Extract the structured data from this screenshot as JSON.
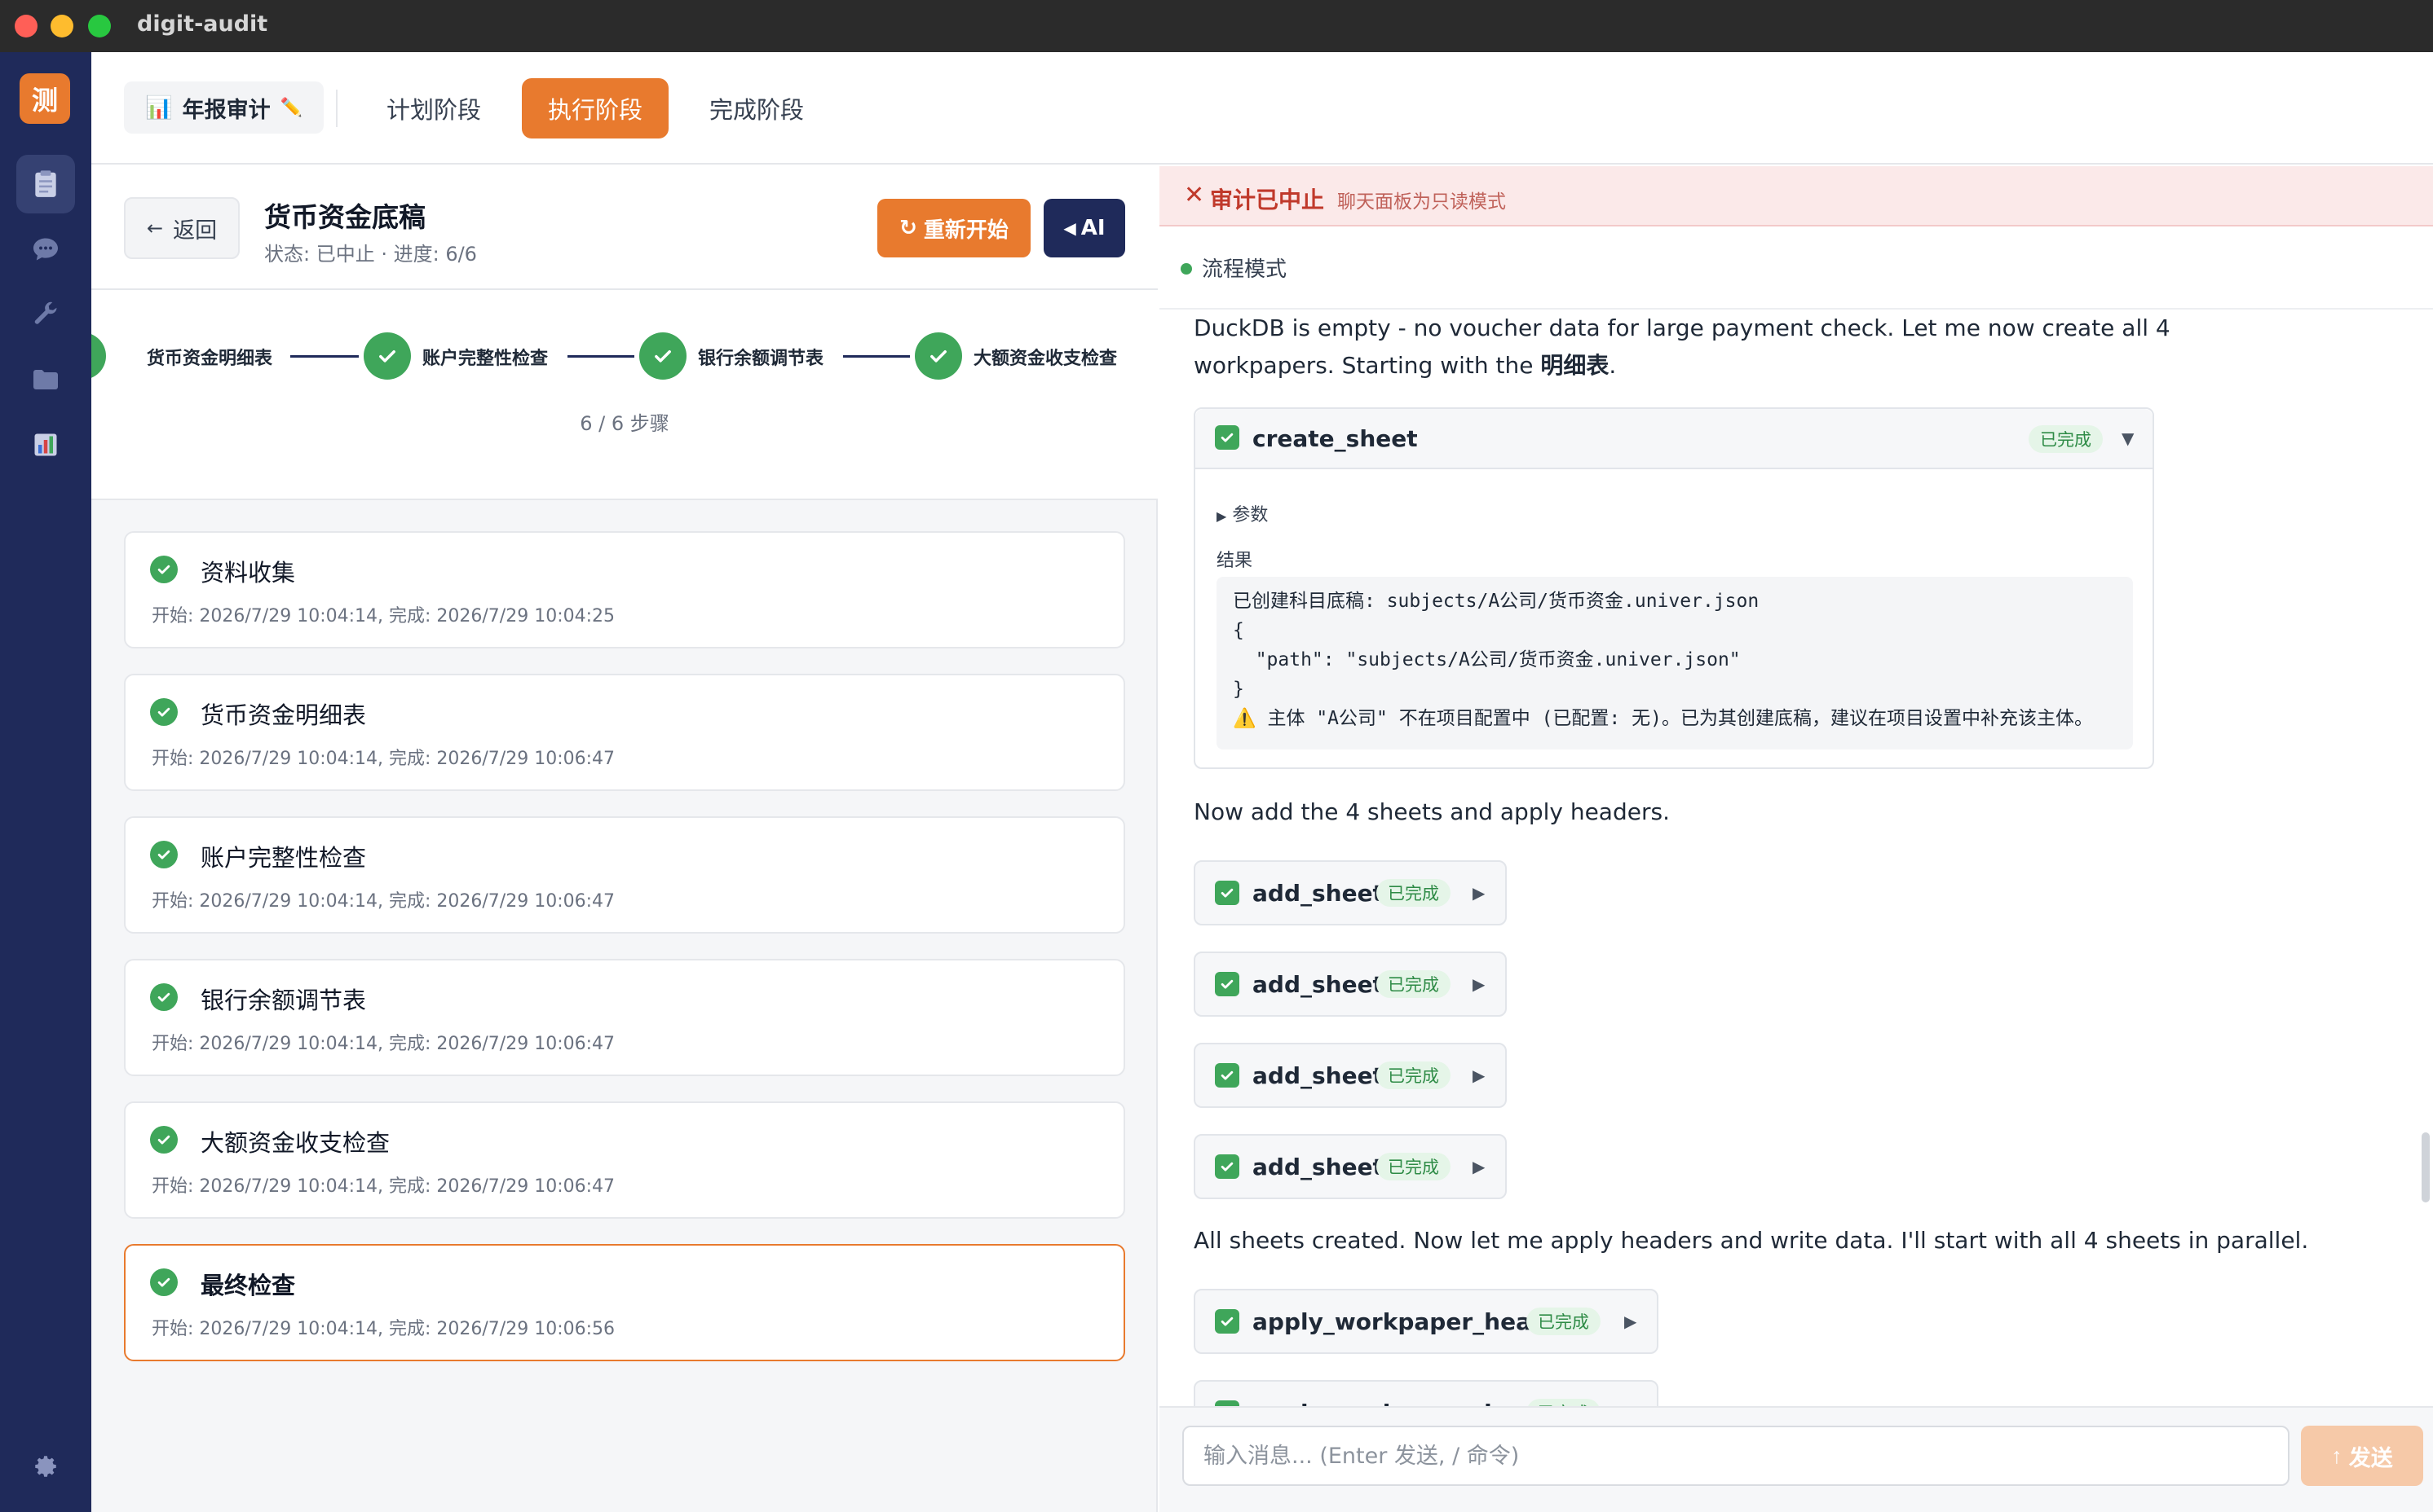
{
  "window": {
    "title": "digit-audit"
  },
  "rail": {
    "logo": "测",
    "items": [
      {
        "icon": "clipboard-icon",
        "active": true
      },
      {
        "icon": "chat-icon",
        "active": false
      },
      {
        "icon": "wrench-icon",
        "active": false
      },
      {
        "icon": "folder-icon",
        "active": false
      },
      {
        "icon": "chart-icon",
        "active": false
      }
    ],
    "settings_icon": "gear-icon"
  },
  "topnav": {
    "project_label": "年报审计",
    "project_emoji": "📊",
    "edit_emoji": "✏️",
    "tabs": [
      {
        "label": "计划阶段",
        "active": false
      },
      {
        "label": "执行阶段",
        "active": true
      },
      {
        "label": "完成阶段",
        "active": false
      }
    ]
  },
  "left": {
    "back_label": "返回",
    "title": "货币资金底稿",
    "status": "状态: 已中止 · 进度: 6/6",
    "restart_label": "重新开始",
    "ai_label": "AI",
    "stepper": {
      "steps": [
        "货币资金明细表",
        "账户完整性检查",
        "银行余额调节表",
        "大额资金收支检查"
      ],
      "count": "6 / 6 步骤"
    },
    "tasks": [
      {
        "name": "资料收集",
        "time": "开始: 2026/7/29 10:04:14, 完成: 2026/7/29 10:04:25"
      },
      {
        "name": "货币资金明细表",
        "time": "开始: 2026/7/29 10:04:14, 完成: 2026/7/29 10:06:47"
      },
      {
        "name": "账户完整性检查",
        "time": "开始: 2026/7/29 10:04:14, 完成: 2026/7/29 10:06:47"
      },
      {
        "name": "银行余额调节表",
        "time": "开始: 2026/7/29 10:04:14, 完成: 2026/7/29 10:06:47"
      },
      {
        "name": "大额资金收支检查",
        "time": "开始: 2026/7/29 10:04:14, 完成: 2026/7/29 10:06:47"
      },
      {
        "name": "最终检查",
        "time": "开始: 2026/7/29 10:04:14, 完成: 2026/7/29 10:06:56"
      }
    ]
  },
  "right": {
    "banner": {
      "icon": "✕",
      "title": "审计已中止",
      "subtitle": "聊天面板为只读模式"
    },
    "mode_label": "流程模式",
    "messages": {
      "m1_line1": "DuckDB is empty - no voucher data for large payment check. Let me now create all 4",
      "m1_line2_pre": "workpapers. Starting with the ",
      "m1_line2_bold": "明细表",
      "m1_line2_post": ".",
      "m2": "Now add the 4 sheets and apply headers.",
      "m3": "All sheets created. Now let me apply headers and write data. I'll start with all 4 sheets in parallel."
    },
    "tool_create": {
      "name": "create_sheet",
      "status": "已完成",
      "params_label": "参数",
      "result_label": "结果",
      "result_text": "已创建科目底稿: subjects/A公司/货币资金.univer.json\n{\n  \"path\": \"subjects/A公司/货币资金.univer.json\"\n}\n⚠️ 主体 \"A公司\" 不在项目配置中 (已配置: 无)。已为其创建底稿，建议在项目设置中补充该主体。"
    },
    "add_sheet_calls": [
      {
        "name": "add_sheet",
        "status": "已完成"
      },
      {
        "name": "add_sheet",
        "status": "已完成"
      },
      {
        "name": "add_sheet",
        "status": "已完成"
      },
      {
        "name": "add_sheet",
        "status": "已完成"
      }
    ],
    "header_calls": [
      {
        "name": "apply_workpaper_header",
        "status": "已完成"
      },
      {
        "name": "apply_workpaper_header",
        "status": "已完成"
      }
    ],
    "input": {
      "placeholder": "输入消息... (Enter 发送, / 命令)",
      "value": ""
    },
    "send_label": "发送"
  }
}
